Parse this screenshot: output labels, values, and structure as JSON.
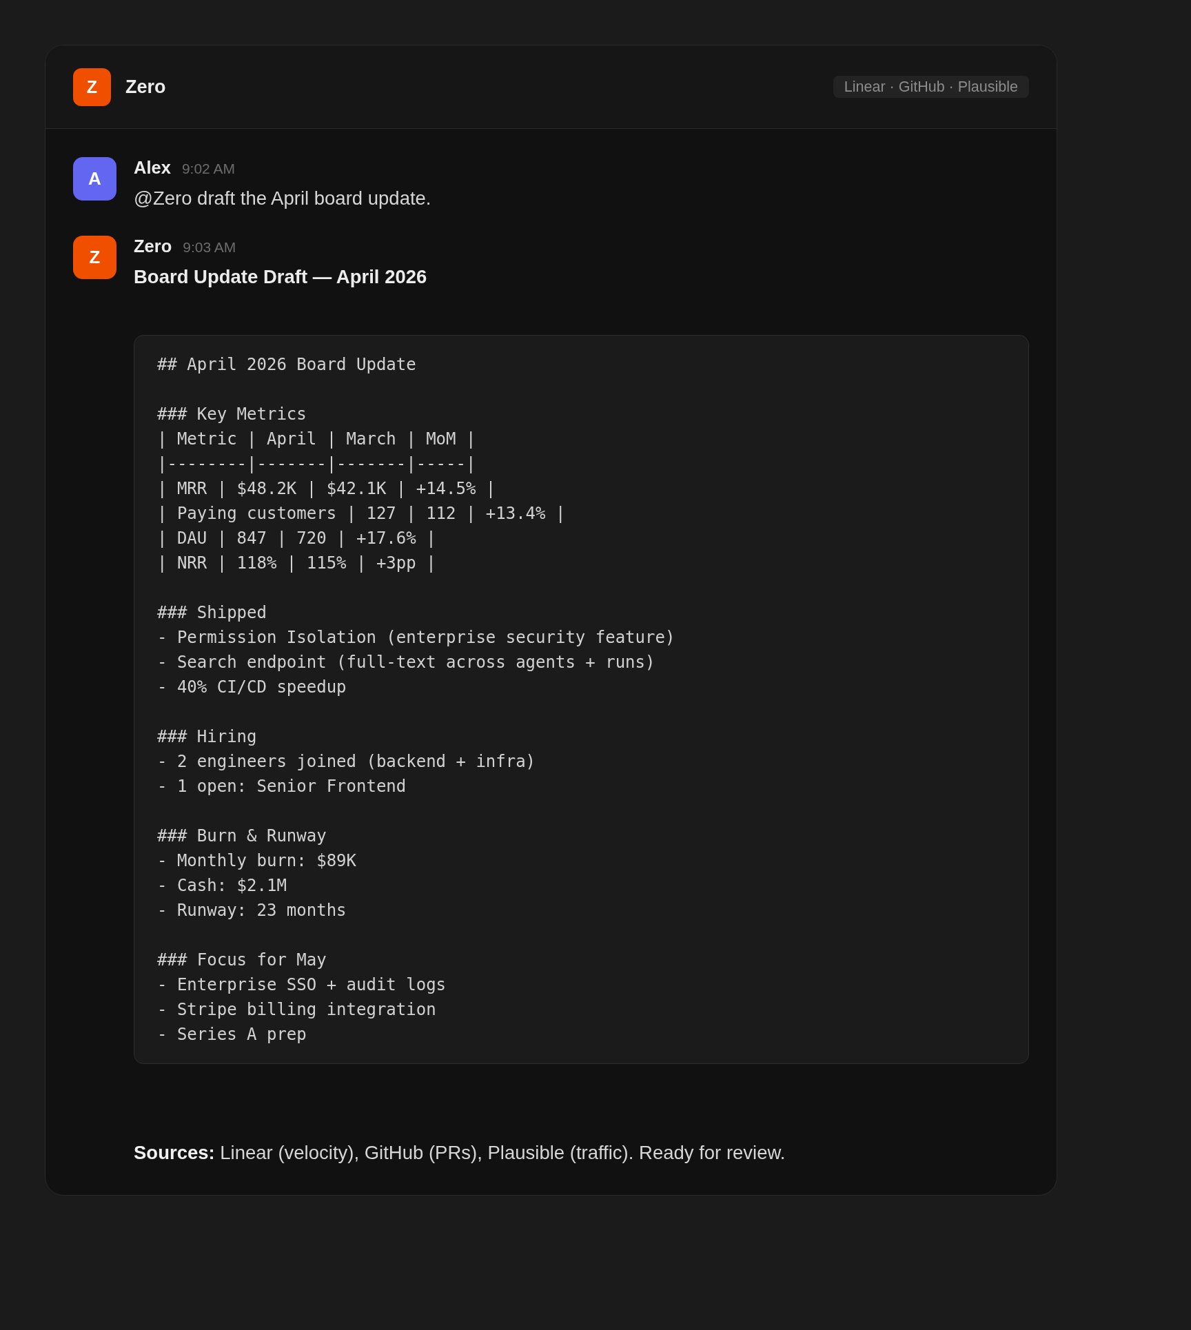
{
  "header": {
    "logo_letter": "Z",
    "title": "Zero",
    "integrations": "Linear · GitHub · Plausible"
  },
  "messages": [
    {
      "kind": "text",
      "author": "Alex",
      "avatar_letter": "A",
      "color": "#6366f1",
      "time": "9:02 AM",
      "text": "@Zero draft the April board update."
    },
    {
      "kind": "draft",
      "author": "Zero",
      "avatar_letter": "Z",
      "color": "#f04f00",
      "time": "9:03 AM",
      "title": "Board Update Draft — April 2026",
      "code_sections": [
        {
          "lines": [
            "## April 2026 Board Update"
          ]
        },
        {
          "lines": [
            "### Key Metrics",
            "| Metric | April | March | MoM |",
            "|--------|-------|-------|-----|",
            "| MRR | $48.2K | $42.1K | +14.5% |",
            "| Paying customers | 127 | 112 | +13.4% |",
            "| DAU | 847 | 720 | +17.6% |",
            "| NRR | 118% | 115% | +3pp |"
          ]
        },
        {
          "lines": [
            "### Shipped",
            "- Permission Isolation (enterprise security feature)",
            "- Search endpoint (full-text across agents + runs)",
            "- 40% CI/CD speedup"
          ]
        },
        {
          "lines": [
            "### Hiring",
            "- 2 engineers joined (backend + infra)",
            "- 1 open: Senior Frontend"
          ]
        },
        {
          "lines": [
            "### Burn & Runway",
            "- Monthly burn: $89K",
            "- Cash: $2.1M",
            "- Runway: 23 months"
          ]
        },
        {
          "lines": [
            "### Focus for May",
            "- Enterprise SSO + audit logs",
            "- Stripe billing integration",
            "- Series A prep"
          ]
        }
      ],
      "footer": "**Sources:** Linear (velocity), GitHub (PRs), Plausible (traffic). Ready for review."
    }
  ]
}
